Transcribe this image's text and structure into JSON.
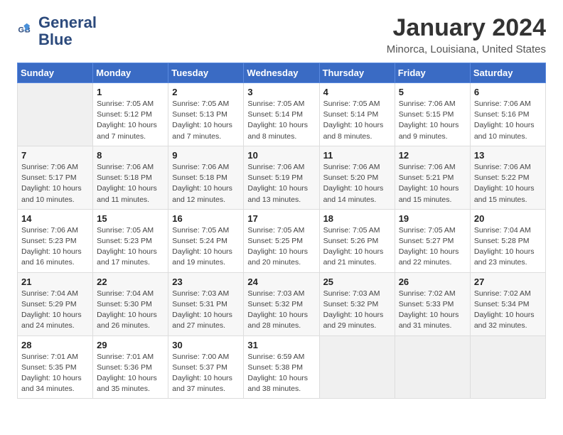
{
  "logo": {
    "name1": "General",
    "name2": "Blue"
  },
  "title": "January 2024",
  "subtitle": "Minorca, Louisiana, United States",
  "headers": [
    "Sunday",
    "Monday",
    "Tuesday",
    "Wednesday",
    "Thursday",
    "Friday",
    "Saturday"
  ],
  "weeks": [
    [
      {
        "num": "",
        "info": ""
      },
      {
        "num": "1",
        "info": "Sunrise: 7:05 AM\nSunset: 5:12 PM\nDaylight: 10 hours\nand 7 minutes."
      },
      {
        "num": "2",
        "info": "Sunrise: 7:05 AM\nSunset: 5:13 PM\nDaylight: 10 hours\nand 7 minutes."
      },
      {
        "num": "3",
        "info": "Sunrise: 7:05 AM\nSunset: 5:14 PM\nDaylight: 10 hours\nand 8 minutes."
      },
      {
        "num": "4",
        "info": "Sunrise: 7:05 AM\nSunset: 5:14 PM\nDaylight: 10 hours\nand 8 minutes."
      },
      {
        "num": "5",
        "info": "Sunrise: 7:06 AM\nSunset: 5:15 PM\nDaylight: 10 hours\nand 9 minutes."
      },
      {
        "num": "6",
        "info": "Sunrise: 7:06 AM\nSunset: 5:16 PM\nDaylight: 10 hours\nand 10 minutes."
      }
    ],
    [
      {
        "num": "7",
        "info": "Sunrise: 7:06 AM\nSunset: 5:17 PM\nDaylight: 10 hours\nand 10 minutes."
      },
      {
        "num": "8",
        "info": "Sunrise: 7:06 AM\nSunset: 5:18 PM\nDaylight: 10 hours\nand 11 minutes."
      },
      {
        "num": "9",
        "info": "Sunrise: 7:06 AM\nSunset: 5:18 PM\nDaylight: 10 hours\nand 12 minutes."
      },
      {
        "num": "10",
        "info": "Sunrise: 7:06 AM\nSunset: 5:19 PM\nDaylight: 10 hours\nand 13 minutes."
      },
      {
        "num": "11",
        "info": "Sunrise: 7:06 AM\nSunset: 5:20 PM\nDaylight: 10 hours\nand 14 minutes."
      },
      {
        "num": "12",
        "info": "Sunrise: 7:06 AM\nSunset: 5:21 PM\nDaylight: 10 hours\nand 15 minutes."
      },
      {
        "num": "13",
        "info": "Sunrise: 7:06 AM\nSunset: 5:22 PM\nDaylight: 10 hours\nand 15 minutes."
      }
    ],
    [
      {
        "num": "14",
        "info": "Sunrise: 7:06 AM\nSunset: 5:23 PM\nDaylight: 10 hours\nand 16 minutes."
      },
      {
        "num": "15",
        "info": "Sunrise: 7:05 AM\nSunset: 5:23 PM\nDaylight: 10 hours\nand 17 minutes."
      },
      {
        "num": "16",
        "info": "Sunrise: 7:05 AM\nSunset: 5:24 PM\nDaylight: 10 hours\nand 19 minutes."
      },
      {
        "num": "17",
        "info": "Sunrise: 7:05 AM\nSunset: 5:25 PM\nDaylight: 10 hours\nand 20 minutes."
      },
      {
        "num": "18",
        "info": "Sunrise: 7:05 AM\nSunset: 5:26 PM\nDaylight: 10 hours\nand 21 minutes."
      },
      {
        "num": "19",
        "info": "Sunrise: 7:05 AM\nSunset: 5:27 PM\nDaylight: 10 hours\nand 22 minutes."
      },
      {
        "num": "20",
        "info": "Sunrise: 7:04 AM\nSunset: 5:28 PM\nDaylight: 10 hours\nand 23 minutes."
      }
    ],
    [
      {
        "num": "21",
        "info": "Sunrise: 7:04 AM\nSunset: 5:29 PM\nDaylight: 10 hours\nand 24 minutes."
      },
      {
        "num": "22",
        "info": "Sunrise: 7:04 AM\nSunset: 5:30 PM\nDaylight: 10 hours\nand 26 minutes."
      },
      {
        "num": "23",
        "info": "Sunrise: 7:03 AM\nSunset: 5:31 PM\nDaylight: 10 hours\nand 27 minutes."
      },
      {
        "num": "24",
        "info": "Sunrise: 7:03 AM\nSunset: 5:32 PM\nDaylight: 10 hours\nand 28 minutes."
      },
      {
        "num": "25",
        "info": "Sunrise: 7:03 AM\nSunset: 5:32 PM\nDaylight: 10 hours\nand 29 minutes."
      },
      {
        "num": "26",
        "info": "Sunrise: 7:02 AM\nSunset: 5:33 PM\nDaylight: 10 hours\nand 31 minutes."
      },
      {
        "num": "27",
        "info": "Sunrise: 7:02 AM\nSunset: 5:34 PM\nDaylight: 10 hours\nand 32 minutes."
      }
    ],
    [
      {
        "num": "28",
        "info": "Sunrise: 7:01 AM\nSunset: 5:35 PM\nDaylight: 10 hours\nand 34 minutes."
      },
      {
        "num": "29",
        "info": "Sunrise: 7:01 AM\nSunset: 5:36 PM\nDaylight: 10 hours\nand 35 minutes."
      },
      {
        "num": "30",
        "info": "Sunrise: 7:00 AM\nSunset: 5:37 PM\nDaylight: 10 hours\nand 37 minutes."
      },
      {
        "num": "31",
        "info": "Sunrise: 6:59 AM\nSunset: 5:38 PM\nDaylight: 10 hours\nand 38 minutes."
      },
      {
        "num": "",
        "info": ""
      },
      {
        "num": "",
        "info": ""
      },
      {
        "num": "",
        "info": ""
      }
    ]
  ]
}
